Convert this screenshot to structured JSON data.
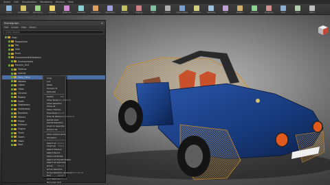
{
  "menubar": {
    "items": [
      "Scene",
      "Edit",
      "Visualization",
      "Rendering",
      "Window",
      "Help"
    ]
  },
  "toolbar": {
    "tools": [
      {
        "label": "Scene",
        "color": "#8ab4d8"
      },
      {
        "label": "Visualization",
        "color": "#d7c36a"
      },
      {
        "label": "Rendering",
        "color": "#9ad08a"
      },
      {
        "label": "Lighting",
        "color": "#e8d36a"
      },
      {
        "label": "Materials",
        "color": "#d08ad0"
      },
      {
        "label": "Cameras",
        "color": "#8ad0d0"
      },
      {
        "label": "Animation",
        "color": "#e0a060"
      },
      {
        "label": "Interaction",
        "color": "#a0a0e0"
      },
      {
        "label": "Variants",
        "color": "#c0c060"
      },
      {
        "label": "Clipping",
        "color": "#d08080"
      },
      {
        "label": "Sets",
        "color": "#80c0a0"
      },
      {
        "label": "Curves",
        "color": "#b0b0b0"
      },
      {
        "label": "Scene Plates",
        "color": "#7aa0d0"
      },
      {
        "label": "Transform",
        "color": "#d0d080"
      },
      {
        "label": "Geometry",
        "color": "#a0c0e0"
      },
      {
        "label": "Edit",
        "color": "#c0a0d0"
      },
      {
        "label": "Rotation",
        "color": "#d0b070"
      },
      {
        "label": "Selection",
        "color": "#90d090"
      },
      {
        "label": "Snapping",
        "color": "#d09090"
      },
      {
        "label": "View",
        "color": "#90b0d0"
      },
      {
        "label": "Tools",
        "color": "#b0d0b0"
      },
      {
        "label": "Other",
        "color": "#c0c0c0"
      }
    ]
  },
  "scenegraph": {
    "title": "Scenegraph",
    "close_icon": "close-icon",
    "menu": [
      "Edit",
      "Create",
      "View",
      "Select"
    ],
    "search_placeholder": "Quick Search",
    "rows": [
      {
        "indent": 2,
        "label": "Root",
        "selected": false
      },
      {
        "indent": 4,
        "label": "Perspective",
        "selected": false
      },
      {
        "indent": 4,
        "label": "Top",
        "selected": false
      },
      {
        "indent": 4,
        "label": "Side",
        "selected": false
      },
      {
        "indent": 4,
        "label": "Front",
        "selected": false
      },
      {
        "indent": 4,
        "label": "EnvironmentsTransform",
        "selected": false
      },
      {
        "indent": 6,
        "label": "Environments",
        "selected": false
      },
      {
        "indent": 4,
        "label": "Porsche_914",
        "selected": false
      },
      {
        "indent": 6,
        "label": "Exterior",
        "selected": false
      },
      {
        "indent": 6,
        "label": "Interior",
        "selected": false
      },
      {
        "indent": 6,
        "label": "Body_Paint",
        "selected": true
      },
      {
        "indent": 6,
        "label": "Wheels",
        "selected": false
      },
      {
        "indent": 6,
        "label": "Lights",
        "selected": false
      },
      {
        "indent": 6,
        "label": "Glass",
        "selected": false
      },
      {
        "indent": 6,
        "label": "Chrome",
        "selected": false
      },
      {
        "indent": 6,
        "label": "Rubber",
        "selected": false
      },
      {
        "indent": 6,
        "label": "Seats",
        "selected": false
      },
      {
        "indent": 6,
        "label": "Dashboard",
        "selected": false
      },
      {
        "indent": 6,
        "label": "Underbody",
        "selected": false
      },
      {
        "indent": 6,
        "label": "Bumpers",
        "selected": false
      },
      {
        "indent": 6,
        "label": "Mirrors",
        "selected": false
      },
      {
        "indent": 6,
        "label": "Plates",
        "selected": false
      },
      {
        "indent": 6,
        "label": "Exhaust",
        "selected": false
      },
      {
        "indent": 6,
        "label": "Engine",
        "selected": false
      },
      {
        "indent": 6,
        "label": "Trunk",
        "selected": false
      },
      {
        "indent": 6,
        "label": "Doors",
        "selected": false
      },
      {
        "indent": 6,
        "label": "Hood",
        "selected": false
      },
      {
        "indent": 6,
        "label": "Roof",
        "selected": false
      }
    ]
  },
  "context_menu": {
    "items": [
      {
        "label": "Copy",
        "shortcut": "",
        "sep": false
      },
      {
        "label": "Cut",
        "shortcut": "",
        "sep": false
      },
      {
        "label": "Paste",
        "shortcut": "",
        "sep": false
      },
      {
        "label": "Convert To",
        "shortcut": "",
        "sep": false
      },
      {
        "label": "Optimize",
        "shortcut": "",
        "sep": true
      },
      {
        "label": "Delete",
        "shortcut": "Del",
        "sep": false
      },
      {
        "label": "Show Node",
        "shortcut": "Ctrl+Shift+S",
        "sep": false
      },
      {
        "label": "Show Selection",
        "shortcut": "",
        "sep": false
      },
      {
        "label": "Show All",
        "shortcut": "",
        "sep": false
      },
      {
        "label": "Show Children",
        "shortcut": "",
        "sep": false
      },
      {
        "label": "Hide Node",
        "shortcut": "Ctrl+H",
        "sep": false
      },
      {
        "label": "Hide All Others",
        "shortcut": "Ctrl+Shift+H",
        "sep": false
      },
      {
        "label": "Isolate View",
        "shortcut": "",
        "sep": false
      },
      {
        "label": "Isolate Selection",
        "shortcut": "",
        "sep": false
      },
      {
        "label": "Zoom to Selection",
        "shortcut": "",
        "sep": false
      },
      {
        "label": "Expand All",
        "shortcut": "",
        "sep": true
      },
      {
        "label": "Show Components",
        "shortcut": "",
        "sep": false
      },
      {
        "label": "Transform",
        "shortcut": "",
        "sep": true
      },
      {
        "label": "Select All",
        "shortcut": "Ctrl+A",
        "sep": false
      },
      {
        "label": "Invert All",
        "shortcut": "Ctrl+I",
        "sep": false
      },
      {
        "label": "Select Children",
        "shortcut": "",
        "sep": false
      },
      {
        "label": "Select Parent",
        "shortcut": "",
        "sep": false
      },
      {
        "label": "Select All Nodes",
        "shortcut": "",
        "sep": false
      },
      {
        "label": "Select All Transformable",
        "shortcut": "",
        "sep": false
      },
      {
        "label": "Select All Switches",
        "shortcut": "",
        "sep": false
      },
      {
        "label": "Group",
        "shortcut": "Ctrl+G",
        "sep": false
      },
      {
        "label": "Group Selection",
        "shortcut": "",
        "sep": false
      },
      {
        "label": "Group Selection as Group",
        "shortcut": "Ctrl+Alt+G",
        "sep": false
      },
      {
        "label": "Find",
        "shortcut": "Ctrl+F",
        "sep": false
      },
      {
        "label": "Sort Selection",
        "shortcut": "Ctrl+T",
        "sep": false
      },
      {
        "label": "Recursive Sort",
        "shortcut": "",
        "sep": false
      },
      {
        "label": "Annotations",
        "shortcut": "",
        "sep": false
      }
    ]
  },
  "viewport": {
    "car_paint_color": "#17397a",
    "wireframe_color": "#e0a23a",
    "interior_color": "#c8502a",
    "navcube_icon": "navigation-cube-icon"
  }
}
